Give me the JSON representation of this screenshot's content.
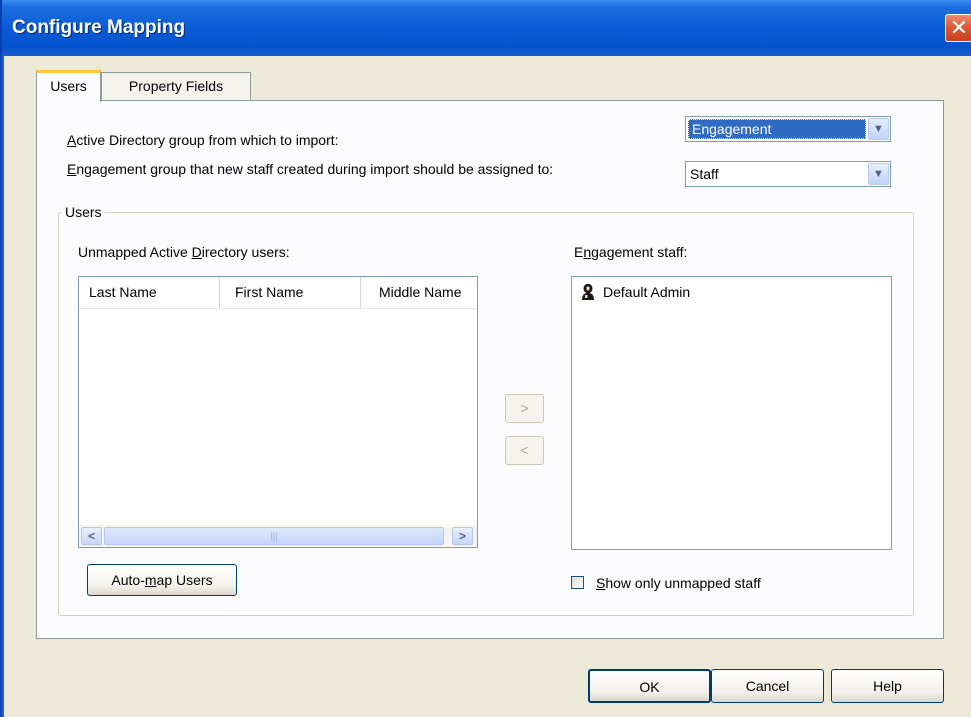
{
  "window": {
    "title": "Configure Mapping",
    "close_glyph": "✕"
  },
  "tabs": [
    {
      "label": "Users",
      "active": true
    },
    {
      "label": "Property Fields",
      "active": false
    }
  ],
  "import": {
    "ad_group_label_access": "A",
    "ad_group_label_rest": "ctive Directory group from which to import:",
    "ad_group_value": "Engagement",
    "eng_group_label_access": "E",
    "eng_group_label_rest": "ngagement group that new staff created during import should be assigned to:",
    "eng_group_value": "Staff"
  },
  "users_group": {
    "title": "Users",
    "unmapped_label_pre": "Unmapped Active ",
    "unmapped_label_access": "D",
    "unmapped_label_post": "irectory users:",
    "columns": [
      "Last Name",
      "First Name",
      "Middle Name"
    ],
    "rows": [],
    "scroll_left": "<",
    "scroll_right": ">",
    "scroll_grip": "|||",
    "move_right_label": ">",
    "move_left_label": "<",
    "staff_label_pre": "E",
    "staff_label_access": "n",
    "staff_label_post": "gagement staff:",
    "staff": [
      {
        "name": "Default Admin",
        "icon": "admin-user-icon"
      }
    ],
    "automap_pre": "Auto-",
    "automap_access": "m",
    "automap_post": "ap Users",
    "show_unmapped_access": "S",
    "show_unmapped_rest": "how only unmapped staff",
    "show_unmapped_checked": false
  },
  "footer": {
    "ok": "OK",
    "cancel": "Cancel",
    "help": "Help"
  },
  "colors": {
    "title_bar": "#0a5ad6",
    "dialog_bg": "#ece9d8",
    "selection": "#316ac5",
    "tab_accent": "#ffc83c",
    "close_button": "#e05530"
  }
}
